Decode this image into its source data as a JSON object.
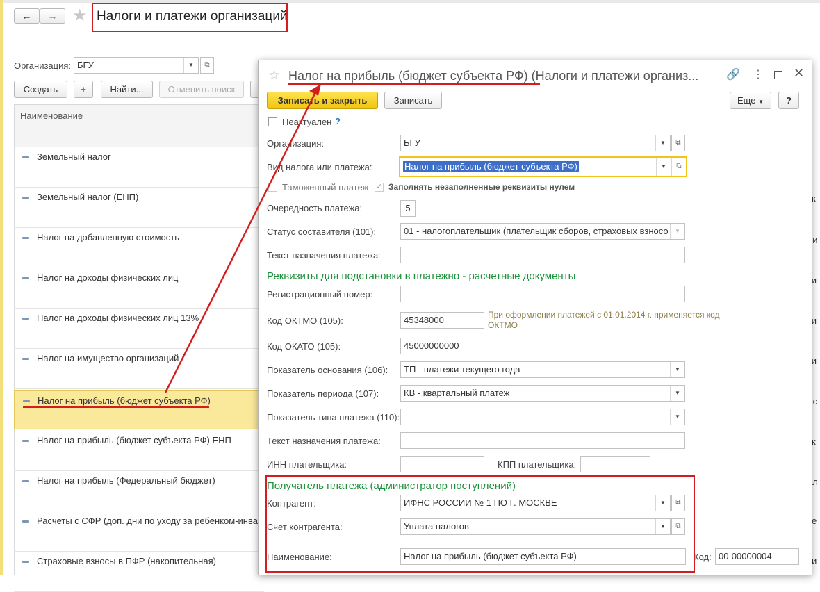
{
  "main": {
    "title": "Налоги и платежи организаций",
    "org_label": "Организация:",
    "org_value": "БГУ",
    "toolbar": {
      "create": "Создать",
      "find": "Найти...",
      "cancel_search": "Отменить поиск"
    },
    "list_header": "Наименование",
    "rows": [
      "Земельный налог",
      "Земельный налог (ЕНП)",
      "Налог на добавленную стоимость",
      "Налог на доходы физических лиц",
      "Налог на доходы физических лиц 13%",
      "Налог на имущество организаций",
      "Налог на прибыль (бюджет субъекта РФ)",
      "Налог на прибыль (бюджет субъекта РФ) ЕНП",
      "Налог на прибыль (Федеральный бюджет)",
      "Расчеты с СФР (доп. дни по уходу за ребенком-инва",
      "Страховые взносы в ПФР (накопительная)"
    ],
    "right_peek": [
      "к",
      "ри",
      "ки",
      "ки",
      "ки",
      "т с",
      "к",
      "ал",
      "е",
      "и"
    ]
  },
  "dialog": {
    "title_part1": "Налог на прибыль (бюджет субъекта РФ)",
    "title_part2": " (Налоги и платежи организ...",
    "btn_save_close": "Записать и закрыть",
    "btn_save": "Записать",
    "btn_more": "Еще",
    "btn_help": "?",
    "not_actual": "Неактуален",
    "help_mark": "?",
    "org_label": "Организация:",
    "org_value": "БГУ",
    "tax_kind_label": "Вид налога или платежа:",
    "tax_kind_value": "Налог на прибыль (бюджет субъекта РФ)",
    "customs_label": "Таможенный платеж",
    "fill_zero_label": "Заполнять незаполненные реквизиты нулем",
    "priority_label": "Очередность платежа:",
    "priority_value": "5",
    "status_label": "Статус составителя (101):",
    "status_value": "01 - налогоплательщик (плательщик сборов, страховых взносо",
    "purpose_label": "Текст назначения платежа:",
    "section1": "Реквизиты для подстановки в платежно - расчетные документы",
    "reg_label": "Регистрационный номер:",
    "oktmo_label": "Код ОКТМО (105):",
    "oktmo_value": "45348000",
    "oktmo_hint": "При оформлении платежей с 01.01.2014 г. применяется код ОКТМО",
    "okato_label": "Код ОКАТО (105):",
    "okato_value": "45000000000",
    "basis_label": "Показатель основания (106):",
    "basis_value": "ТП - платежи текущего года",
    "period_label": "Показатель периода (107):",
    "period_value": "КВ - квартальный платеж",
    "paytype_label": "Показатель типа платежа (110):",
    "purpose2_label": "Текст назначения платежа:",
    "inn_label": "ИНН плательщика:",
    "kpp_label": "КПП плательщика:",
    "section2": "Получатель платежа (администратор поступлений)",
    "contractor_label": "Контрагент:",
    "contractor_value": "ИФНС РОССИИ № 1 ПО Г. МОСКВЕ",
    "account_label": "Счет контрагента:",
    "account_value": "Уплата налогов",
    "name_label": "Наименование:",
    "name_value": "Налог на прибыль (бюджет субъекта РФ)",
    "code_label": "Код:",
    "code_value": "00-00000004"
  },
  "colors": {
    "annotation_red": "#d41e1e",
    "section_green": "#1c8f3a",
    "primary_button": "#f1c40f"
  }
}
